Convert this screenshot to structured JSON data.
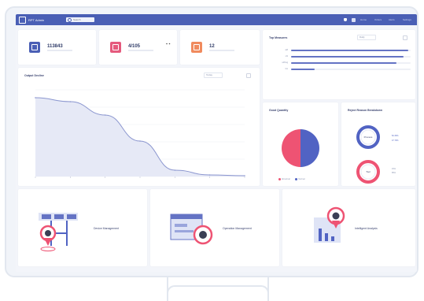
{
  "app": {
    "title": "RPT Admin"
  },
  "search": {
    "placeholder": "Search"
  },
  "topbar": {
    "links": [
      "Home",
      "Orders",
      "Alerts",
      "Settings"
    ]
  },
  "colors": {
    "brand": "#4a5fb5",
    "stat_blue": "#4a5fb5",
    "stat_pink": "#e55a7d",
    "stat_orange": "#f08a5d",
    "pie_blue": "#5163c3",
    "pie_pink": "#ee5373"
  },
  "stats": [
    {
      "value": "113843",
      "icon": "box-icon",
      "color": "#4a5fb5"
    },
    {
      "value": "4/105",
      "icon": "alert-icon",
      "color": "#e55a7d"
    },
    {
      "value": "12",
      "icon": "doc-icon",
      "color": "#f08a5d"
    }
  ],
  "top_panel": {
    "title": "Top Measures",
    "select": "Daily",
    "rows": [
      {
        "label": "adf",
        "fraction": 0.98
      },
      {
        "label": "sf1",
        "fraction": 0.94
      },
      {
        "label": "s4%ng",
        "fraction": 0.88
      },
      {
        "label": "fox",
        "fraction": 0.2
      }
    ]
  },
  "line_panel": {
    "title": "Output Decline",
    "select": "Today"
  },
  "chart_data": {
    "type": "area",
    "x": [
      "Jan",
      "Feb",
      "Mar",
      "Apr",
      "May",
      "Jun",
      "Jul"
    ],
    "y": [
      100,
      95,
      78,
      45,
      8,
      2,
      1
    ],
    "ylim": [
      0,
      110
    ],
    "grid": true
  },
  "pie_panel": {
    "title": "Good Quantity",
    "slices": [
      {
        "label": "Normal",
        "value": 50,
        "color": "#5163c3"
      },
      {
        "label": "Abnormal",
        "value": 50,
        "color": "#ee5373"
      }
    ]
  },
  "donut_panel": {
    "title": "Reject Reason Breakdown",
    "items": [
      {
        "label": "Process",
        "color": "#5163c3",
        "legend": [
          "52.30%",
          "47.70%"
        ]
      },
      {
        "label": "Tool",
        "color": "#ee5373",
        "legend": [
          "15%",
          "85%"
        ]
      }
    ]
  },
  "features": [
    {
      "label": "Device Management",
      "icon": "table-pin-icon"
    },
    {
      "label": "Operation Management",
      "icon": "window-pin-icon"
    },
    {
      "label": "Intelligent Analysis",
      "icon": "chart-pin-icon"
    }
  ]
}
